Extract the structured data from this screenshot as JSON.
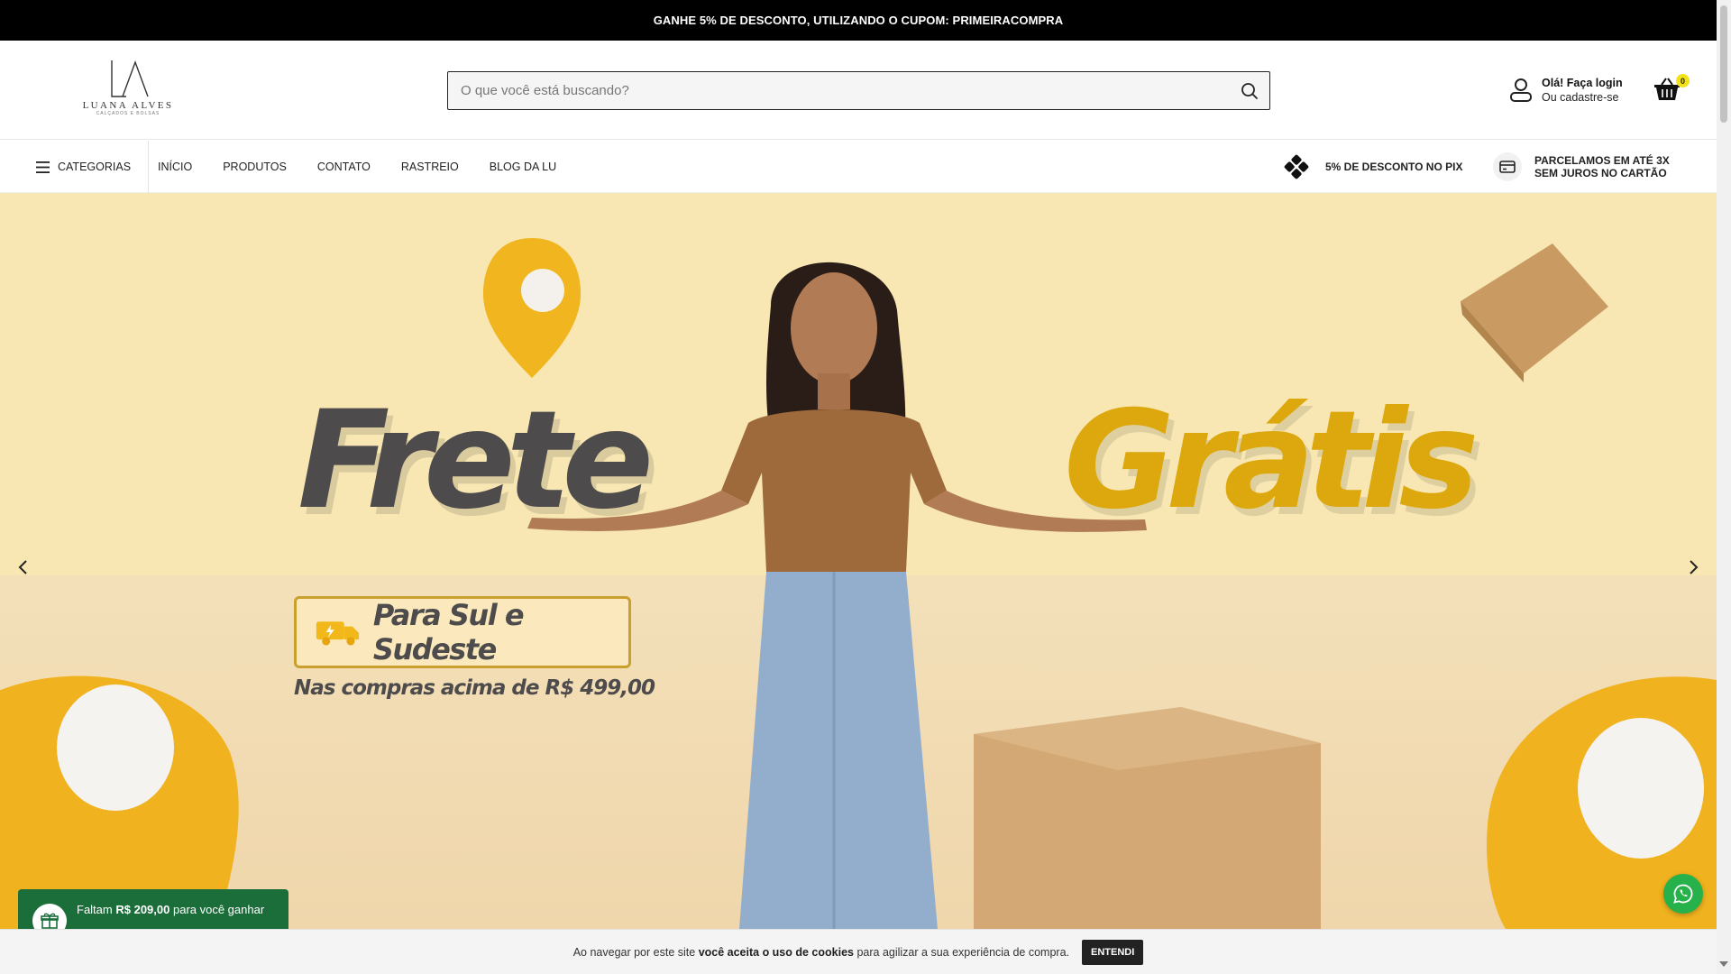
{
  "announcement": "GANHE 5% DE DESCONTO, UTILIZANDO O CUPOM: PRIMEIRACOMPRA",
  "logo": {
    "mark": "LA",
    "name": "LUANA ALVES",
    "tagline": "CALÇADOS E BOLSAS"
  },
  "search": {
    "placeholder": "O que você está buscando?",
    "value": "",
    "icon": "search-icon"
  },
  "account": {
    "line1": "Olá! Faça login",
    "line2": "Ou cadastre-se",
    "icon": "user-icon"
  },
  "cart": {
    "count": "0",
    "icon": "basket-icon",
    "badge_color": "#f3e21a"
  },
  "nav": {
    "categories_label": "CATEGORIAS",
    "links": [
      "INÍCIO",
      "PRODUTOS",
      "CONTATO",
      "RASTREIO",
      "BLOG DA LU"
    ]
  },
  "perks": {
    "pix": "5% DE DESCONTO NO PIX",
    "card_line1": "PARCELAMOS EM ATÉ 3X",
    "card_line2": "SEM JUROS NO CARTÃO"
  },
  "hero": {
    "title_left": "Frete",
    "title_right": "Grátis",
    "box_text": "Para Sul e Sudeste",
    "subtext": "Nas compras acima de R$ 499,00",
    "colors": {
      "accent": "#dca80d",
      "dark": "#4d4b4b",
      "background": "#f8e7b3"
    }
  },
  "free_shipping_bar": {
    "prefix": "Faltam ",
    "amount": "R$ 209,00",
    "suffix": " para você ganhar",
    "color": "#1b6e3a"
  },
  "whatsapp": {
    "icon": "whatsapp-icon",
    "color": "#27b14b"
  },
  "cookie": {
    "text_before": "Ao navegar por este site ",
    "text_bold": "você aceita o uso de cookies",
    "text_after": " para agilizar a sua experiência de compra.",
    "button": "ENTENDI"
  }
}
